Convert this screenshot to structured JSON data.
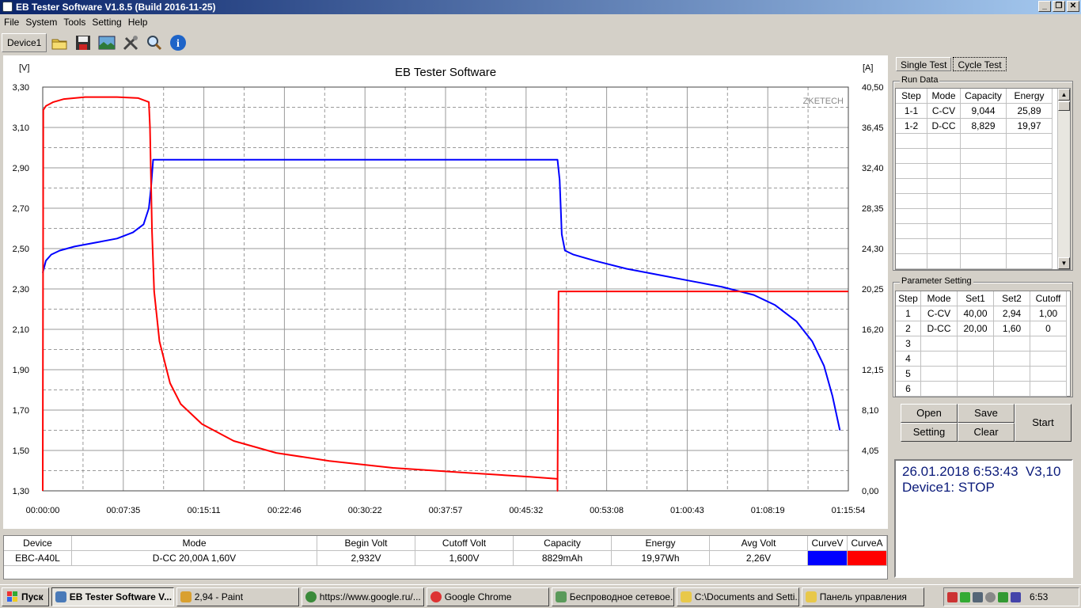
{
  "window": {
    "title": "EB Tester Software V1.8.5 (Build 2016-11-25)"
  },
  "menu": [
    "File",
    "System",
    "Tools",
    "Setting",
    "Help"
  ],
  "toolbar": {
    "device_tab": "Device1"
  },
  "chart_data": {
    "type": "line",
    "title": "EB Tester Software",
    "watermark": "ZKETECH",
    "ylabel_left": "[V]",
    "ylabel_right": "[A]",
    "x_ticks": [
      "00:00:00",
      "00:07:35",
      "00:15:11",
      "00:22:46",
      "00:30:22",
      "00:37:57",
      "00:45:32",
      "00:53:08",
      "01:00:43",
      "01:08:19",
      "01:15:54"
    ],
    "x_range_min": [
      0,
      75.9
    ],
    "y_left_ticks": [
      "3,30",
      "3,10",
      "2,90",
      "2,70",
      "2,50",
      "2,30",
      "2,10",
      "1,90",
      "1,70",
      "1,50",
      "1,30"
    ],
    "y_left_range": [
      1.3,
      3.3
    ],
    "y_right_ticks": [
      "40,50",
      "36,45",
      "32,40",
      "28,35",
      "24,30",
      "20,25",
      "16,20",
      "12,15",
      "8,10",
      "4,05",
      "0,00"
    ],
    "y_right_range": [
      0,
      40.5
    ],
    "grid": true,
    "series": [
      {
        "name": "CurveV",
        "color": "#0000ff",
        "axis": "left",
        "x": [
          0,
          0.3,
          0.8,
          1.6,
          3,
          5,
          7,
          8.5,
          9.5,
          10,
          10.2,
          10.4,
          20,
          30,
          40,
          48.5,
          48.7,
          48.9,
          49.2,
          50,
          52,
          55,
          58,
          61,
          64,
          67,
          69,
          71,
          72.5,
          73.6,
          74.4,
          75.1
        ],
        "y": [
          2.38,
          2.44,
          2.47,
          2.49,
          2.51,
          2.53,
          2.55,
          2.58,
          2.62,
          2.7,
          2.8,
          2.94,
          2.94,
          2.94,
          2.94,
          2.94,
          2.84,
          2.57,
          2.49,
          2.47,
          2.44,
          2.4,
          2.37,
          2.34,
          2.31,
          2.27,
          2.22,
          2.14,
          2.04,
          1.92,
          1.77,
          1.6
        ]
      },
      {
        "name": "CurveA",
        "color": "#ff0000",
        "axis": "right",
        "x": [
          0,
          0.05,
          0.3,
          1,
          2,
          4,
          7,
          9,
          10,
          10.1,
          10.3,
          10.5,
          11,
          12,
          13,
          15,
          18,
          22,
          27,
          33,
          40,
          46,
          48.5,
          48.5,
          48.6,
          75.9
        ],
        "y": [
          0,
          38.2,
          38.6,
          39.0,
          39.3,
          39.5,
          39.5,
          39.4,
          39.0,
          36.5,
          26,
          20,
          15.0,
          10.8,
          8.7,
          6.7,
          5.0,
          3.8,
          3.0,
          2.3,
          1.8,
          1.4,
          1.2,
          0,
          20.0,
          20.0
        ]
      }
    ]
  },
  "bottom_table": {
    "headers": [
      "Device",
      "Mode",
      "Begin Volt",
      "Cutoff Volt",
      "Capacity",
      "Energy",
      "Avg Volt",
      "CurveV",
      "CurveA"
    ],
    "row": [
      "EBC-A40L",
      "D-CC 20,00A 1,60V",
      "2,932V",
      "1,600V",
      "8829mAh",
      "19,97Wh",
      "2,26V"
    ],
    "curve_colors": [
      "#0000ff",
      "#ff0000"
    ]
  },
  "tabs": [
    "Single Test",
    "Cycle Test"
  ],
  "run_data": {
    "title": "Run Data",
    "headers": [
      "Step",
      "Mode",
      "Capacity",
      "Energy"
    ],
    "rows": [
      [
        "1-1",
        "C-CV",
        "9,044",
        "25,89"
      ],
      [
        "1-2",
        "D-CC",
        "8,829",
        "19,97"
      ]
    ]
  },
  "param": {
    "title": "Parameter Setting",
    "headers": [
      "Step",
      "Mode",
      "Set1",
      "Set2",
      "Cutoff"
    ],
    "rows": [
      [
        "1",
        "C-CV",
        "40,00",
        "2,94",
        "1,00"
      ],
      [
        "2",
        "D-CC",
        "20,00",
        "1,60",
        "0"
      ],
      [
        "3",
        "",
        "",
        "",
        ""
      ],
      [
        "4",
        "",
        "",
        "",
        ""
      ],
      [
        "5",
        "",
        "",
        "",
        ""
      ],
      [
        "6",
        "",
        "",
        "",
        ""
      ]
    ]
  },
  "buttons": {
    "open": "Open",
    "save": "Save",
    "setting": "Setting",
    "clear": "Clear",
    "start": "Start"
  },
  "status": {
    "line1": "26.01.2018 6:53:43  V3,10",
    "line2": "Device1: STOP"
  },
  "taskbar": {
    "start": "Пуск",
    "tasks": [
      "EB Tester Software V...",
      "2,94 - Paint",
      "https://www.google.ru/...",
      "Google Chrome",
      "Беспроводное сетевое...",
      "C:\\Documents and Setti...",
      "Панель управления"
    ],
    "clock": "6:53"
  }
}
